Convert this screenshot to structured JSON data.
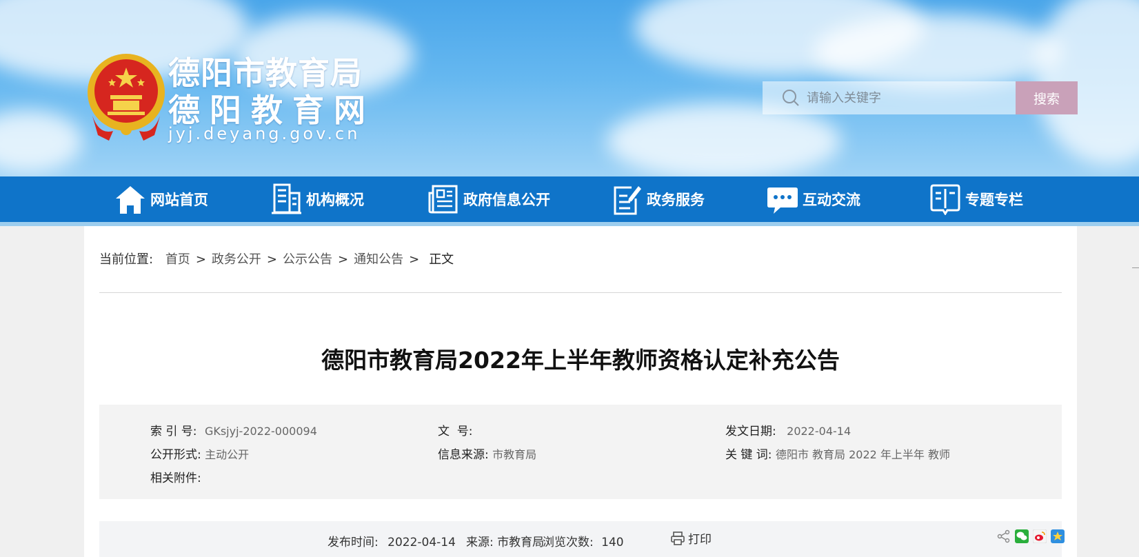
{
  "site": {
    "name_line1": "德阳市教育局",
    "name_line2": "德阳教育网",
    "domain": "jyj.deyang.gov.cn"
  },
  "search": {
    "placeholder": "请输入关键字",
    "button_label": "搜索"
  },
  "nav": {
    "items": [
      {
        "label": "网站首页",
        "icon": "home-icon"
      },
      {
        "label": "机构概况",
        "icon": "building-icon"
      },
      {
        "label": "政府信息公开",
        "icon": "newspaper-icon"
      },
      {
        "label": "政务服务",
        "icon": "document-edit-icon"
      },
      {
        "label": "互动交流",
        "icon": "chat-bubble-icon"
      },
      {
        "label": "专题专栏",
        "icon": "book-icon"
      }
    ]
  },
  "breadcrumb": {
    "prefix": "当前位置:",
    "items": [
      "首页",
      "政务公开",
      "公示公告",
      "通知公告"
    ],
    "current": "正文"
  },
  "article": {
    "title": "德阳市教育局2022年上半年教师资格认定补充公告"
  },
  "meta": {
    "index_label": "索 引 号:",
    "index_value": "GKsjyj-2022-000094",
    "docno_label": "文  号:",
    "docno_value": "",
    "date_label": "发文日期:",
    "date_value": "2022-04-14",
    "form_label": "公开形式:",
    "form_value": "主动公开",
    "source_label": "信息来源:",
    "source_value": "市教育局",
    "keywords_label": "关 键 词:",
    "keywords_value": "德阳市 教育局 2022 年上半年 教师",
    "attach_label": "相关附件:"
  },
  "infobar": {
    "publish_label": "发布时间:",
    "publish_value": "2022-04-14",
    "source_label": "来源:",
    "source_value": "市教育局",
    "views_label": "浏览次数:",
    "views_value": "140",
    "print_label": "打印"
  },
  "colors": {
    "nav_bg": "#0f74c9",
    "search_button": "#c9a1b9",
    "header_sky": "#4aa6ea"
  }
}
